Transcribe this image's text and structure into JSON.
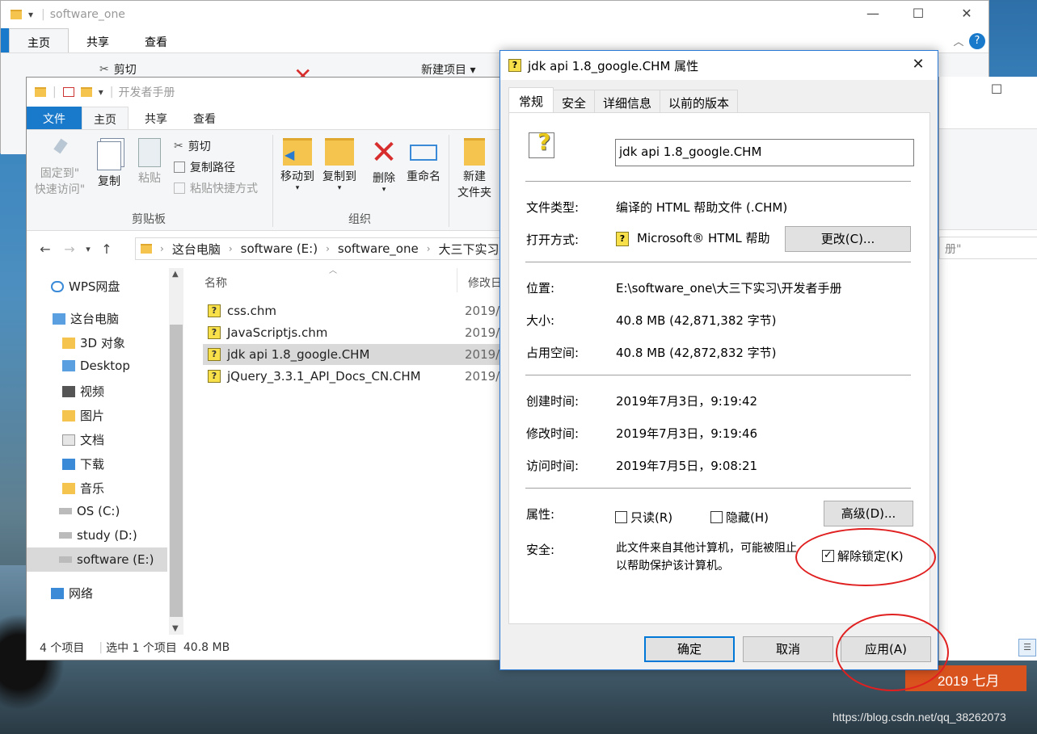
{
  "desktop": {
    "calendar": "2019 七月",
    "watermark": "https://blog.csdn.net/qq_38262073"
  },
  "back_window": {
    "title": "software_one",
    "tabs": [
      "主页",
      "共享",
      "查看"
    ],
    "ribbon": {
      "cut": "剪切",
      "new_item": "新建项目 ▾"
    }
  },
  "explorer": {
    "title": "开发者手册",
    "tabs": {
      "file": "文件",
      "home": "主页",
      "share": "共享",
      "view": "查看"
    },
    "ribbon": {
      "pin": "固定到\"\n快速访问\"",
      "copy": "复制",
      "paste": "粘贴",
      "cut": "剪切",
      "copy_path": "复制路径",
      "paste_shortcut": "粘贴快捷方式",
      "move_to": "移动到",
      "copy_to": "复制到",
      "delete": "删除",
      "rename": "重命名",
      "new_folder_1": "新建",
      "new_folder_2": "文件夹",
      "group_clipboard": "剪贴板",
      "group_organize": "组织"
    },
    "breadcrumbs": [
      "这台电脑",
      "software (E:)",
      "software_one",
      "大三下实习"
    ],
    "nav": [
      {
        "label": "WPS网盘",
        "icon": "cloud-icon"
      },
      {
        "label": "这台电脑",
        "icon": "computer-icon"
      },
      {
        "label": "3D 对象",
        "icon": "3d-objects-icon"
      },
      {
        "label": "Desktop",
        "icon": "desktop-folder-icon"
      },
      {
        "label": "视频",
        "icon": "video-folder-icon"
      },
      {
        "label": "图片",
        "icon": "pictures-folder-icon"
      },
      {
        "label": "文档",
        "icon": "documents-folder-icon"
      },
      {
        "label": "下载",
        "icon": "downloads-folder-icon"
      },
      {
        "label": "音乐",
        "icon": "music-folder-icon"
      },
      {
        "label": "OS (C:)",
        "icon": "drive-icon"
      },
      {
        "label": "study (D:)",
        "icon": "drive-icon"
      },
      {
        "label": "software (E:)",
        "icon": "drive-icon"
      },
      {
        "label": "网络",
        "icon": "network-icon"
      }
    ],
    "columns": {
      "name": "名称",
      "modified": "修改日"
    },
    "files": [
      {
        "name": "css.chm",
        "date": "2019/"
      },
      {
        "name": "JavaScriptjs.chm",
        "date": "2019/"
      },
      {
        "name": "jdk api 1.8_google.CHM",
        "date": "2019/"
      },
      {
        "name": "jQuery_3.3.1_API_Docs_CN.CHM",
        "date": "2019/"
      }
    ],
    "status": {
      "count": "4 个项目",
      "selected": "选中 1 个项目",
      "size": "40.8 MB"
    }
  },
  "right_window": {
    "search_text": "册\""
  },
  "dialog": {
    "title": "jdk api 1.8_google.CHM 属性",
    "tabs": [
      "常规",
      "安全",
      "详细信息",
      "以前的版本"
    ],
    "filename": "jdk api 1.8_google.CHM",
    "rows": {
      "type_label": "文件类型:",
      "type_value": "编译的 HTML 帮助文件 (.CHM)",
      "open_label": "打开方式:",
      "open_value": "Microsoft® HTML 帮助",
      "change_btn": "更改(C)...",
      "location_label": "位置:",
      "location_value": "E:\\software_one\\大三下实习\\开发者手册",
      "size_label": "大小:",
      "size_value": "40.8 MB (42,871,382 字节)",
      "disk_label": "占用空间:",
      "disk_value": "40.8 MB (42,872,832 字节)",
      "created_label": "创建时间:",
      "created_value": "2019年7月3日，9:19:42",
      "modified_label": "修改时间:",
      "modified_value": "2019年7月3日，9:19:46",
      "accessed_label": "访问时间:",
      "accessed_value": "2019年7月5日，9:08:21",
      "attr_label": "属性:",
      "readonly": "只读(R)",
      "hidden": "隐藏(H)",
      "advanced_btn": "高级(D)...",
      "security_label": "安全:",
      "security_text_1": "此文件来自其他计算机，可能被阻止",
      "security_text_2": "以帮助保护该计算机。",
      "unblock": "解除锁定(K)"
    },
    "buttons": {
      "ok": "确定",
      "cancel": "取消",
      "apply": "应用(A)"
    }
  }
}
